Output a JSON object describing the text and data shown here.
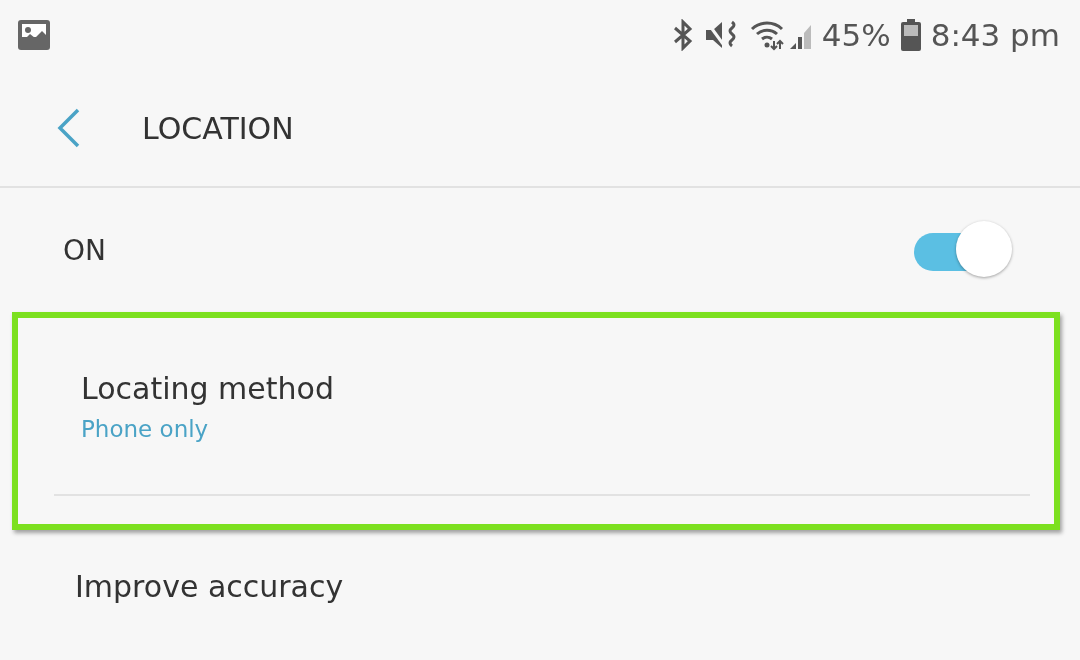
{
  "status_bar": {
    "battery": "45%",
    "time": "8:43 pm"
  },
  "header": {
    "title": "LOCATION"
  },
  "master_switch": {
    "label": "ON",
    "on": true
  },
  "items": [
    {
      "title": "Locating method",
      "subtitle": "Phone only",
      "highlighted": true
    },
    {
      "title": "Improve accuracy",
      "highlighted": false
    }
  ]
}
